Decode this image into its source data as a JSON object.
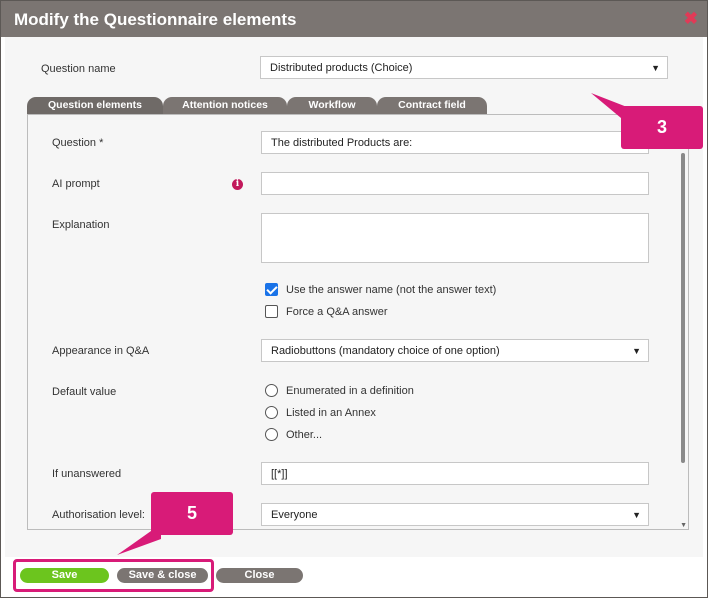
{
  "dialog": {
    "title": "Modify the Questionnaire elements",
    "close_glyph": "✖"
  },
  "question_name": {
    "label": "Question name",
    "value": "Distributed products (Choice)"
  },
  "tabs": [
    {
      "label": "Question elements",
      "active": true
    },
    {
      "label": "Attention notices",
      "active": false
    },
    {
      "label": "Workflow",
      "active": false
    },
    {
      "label": "Contract field",
      "active": false
    }
  ],
  "form": {
    "question": {
      "label": "Question *",
      "value": "The distributed Products are:"
    },
    "ai_prompt": {
      "label": "AI prompt",
      "value": "",
      "info_glyph": "i"
    },
    "explanation": {
      "label": "Explanation",
      "value": ""
    },
    "use_answer_name": {
      "label": "Use the answer name (not the answer text)",
      "checked": true
    },
    "force_qa": {
      "label": "Force a Q&A answer",
      "checked": false
    },
    "appearance": {
      "label": "Appearance in Q&A",
      "value": "Radiobuttons (mandatory choice of one option)"
    },
    "default_value": {
      "label": "Default value",
      "options": [
        "Enumerated in a definition",
        "Listed in an Annex",
        "Other..."
      ]
    },
    "if_unanswered": {
      "label": "If unanswered",
      "value": "[[*]]"
    },
    "authorisation": {
      "label": "Authorisation level:",
      "value": "Everyone"
    }
  },
  "callouts": {
    "three": "3",
    "five": "5"
  },
  "buttons": {
    "save": "Save",
    "save_close": "Save & close",
    "close": "Close"
  },
  "colors": {
    "accent_pink": "#d81b78",
    "save_green": "#6cc51e",
    "button_gray": "#7b7572",
    "checkbox_blue": "#1a73e8"
  }
}
